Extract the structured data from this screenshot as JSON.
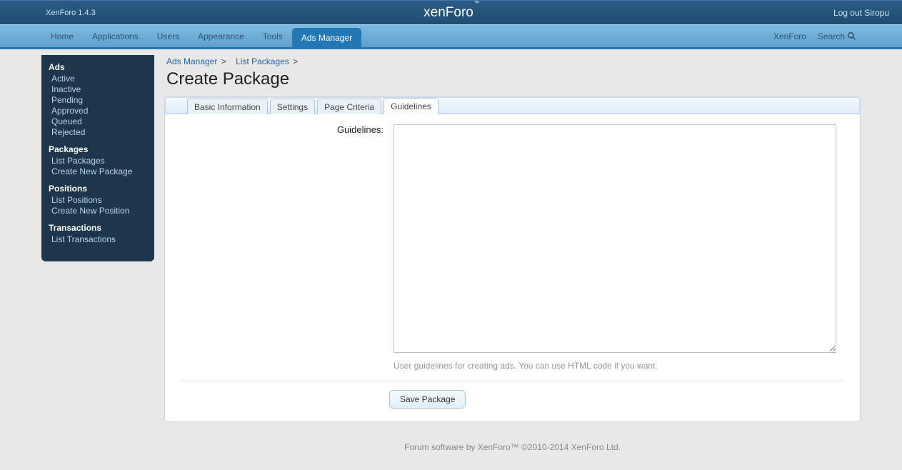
{
  "header": {
    "version": "XenForo 1.4.3",
    "logo_pre": "xen",
    "logo_post": "Foro",
    "logout": "Log out Siropu"
  },
  "nav": {
    "items": [
      "Home",
      "Applications",
      "Users",
      "Appearance",
      "Tools",
      "Ads Manager"
    ],
    "active_index": 5,
    "right_link": "XenForo",
    "search_label": "Search"
  },
  "sidebar": [
    {
      "heading": "Ads",
      "links": [
        "Active",
        "Inactive",
        "Pending",
        "Approved",
        "Queued",
        "Rejected"
      ]
    },
    {
      "heading": "Packages",
      "links": [
        "List Packages",
        "Create New Package"
      ]
    },
    {
      "heading": "Positions",
      "links": [
        "List Positions",
        "Create New Position"
      ]
    },
    {
      "heading": "Transactions",
      "links": [
        "List Transactions"
      ]
    }
  ],
  "breadcrumb": [
    "Ads Manager",
    "List Packages"
  ],
  "page_title": "Create Package",
  "tabs": {
    "items": [
      "Basic Information",
      "Settings",
      "Page Criteria",
      "Guidelines"
    ],
    "active_index": 3
  },
  "form": {
    "guidelines_label": "Guidelines:",
    "guidelines_value": "",
    "hint": "User guidelines for creating ads. You can use HTML code if you want.",
    "save": "Save Package"
  },
  "footer": "Forum software by XenForo™ ©2010-2014 XenForo Ltd."
}
